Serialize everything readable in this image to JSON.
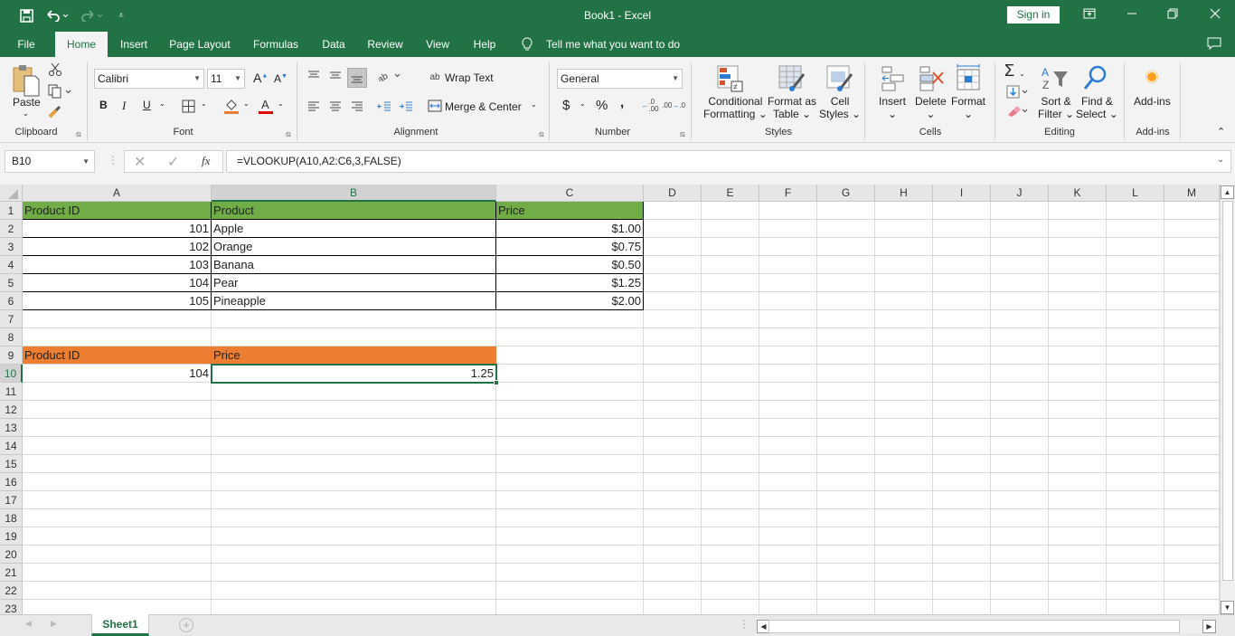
{
  "window": {
    "title": "Book1  -  Excel",
    "sign_in": "Sign in",
    "icons": {
      "save": "save-icon",
      "undo": "undo-icon",
      "redo": "redo-icon",
      "customize": "customize-qat-icon",
      "ribbon_display": "ribbon-display-options-icon",
      "minimize": "minimize-icon",
      "restore": "restore-icon",
      "close": "close-icon",
      "comments": "comments-icon"
    }
  },
  "tabs": [
    {
      "label": "File",
      "active": false
    },
    {
      "label": "Home",
      "active": true
    },
    {
      "label": "Insert",
      "active": false
    },
    {
      "label": "Page Layout",
      "active": false
    },
    {
      "label": "Formulas",
      "active": false
    },
    {
      "label": "Data",
      "active": false
    },
    {
      "label": "Review",
      "active": false
    },
    {
      "label": "View",
      "active": false
    },
    {
      "label": "Help",
      "active": false
    }
  ],
  "tell_me": "Tell me what you want to do",
  "ribbon": {
    "clipboard": {
      "label": "Clipboard",
      "paste": "Paste"
    },
    "font": {
      "label": "Font",
      "name": "Calibri",
      "size": "11",
      "bold": "B",
      "italic": "I",
      "underline": "U",
      "fill_color": "#ed7d31",
      "font_color": "#e00000"
    },
    "alignment": {
      "label": "Alignment",
      "wrap_text": "Wrap Text",
      "merge_center": "Merge & Center"
    },
    "number": {
      "label": "Number",
      "format": "General",
      "currency": "$",
      "percent": "%",
      "comma": ","
    },
    "styles": {
      "label": "Styles",
      "conditional_1": "Conditional",
      "conditional_2": "Formatting",
      "format_table_1": "Format as",
      "format_table_2": "Table",
      "cell_styles_1": "Cell",
      "cell_styles_2": "Styles"
    },
    "cells": {
      "label": "Cells",
      "insert": "Insert",
      "delete": "Delete",
      "format": "Format"
    },
    "editing": {
      "label": "Editing",
      "sort_1": "Sort &",
      "sort_2": "Filter",
      "find_1": "Find &",
      "find_2": "Select"
    },
    "addins": {
      "label": "Add-ins",
      "button": "Add-ins"
    }
  },
  "formula_bar": {
    "name_box": "B10",
    "fx": "fx",
    "formula": "=VLOOKUP(A10,A2:C6,3,FALSE)"
  },
  "sheet": {
    "columns": [
      "A",
      "B",
      "C",
      "D",
      "E",
      "F",
      "G",
      "H",
      "I",
      "J",
      "K",
      "L",
      "M"
    ],
    "selected_column": "B",
    "selected_row": 10,
    "rows": [
      1,
      2,
      3,
      4,
      5,
      6,
      7,
      8,
      9,
      10,
      11,
      12,
      13,
      14,
      15,
      16,
      17,
      18,
      19,
      20,
      21,
      22,
      23
    ],
    "table1": {
      "headers": [
        "Product ID",
        "Product",
        "Price"
      ],
      "header_color": "#70ad47",
      "data": [
        [
          "101",
          "Apple",
          "$1.00"
        ],
        [
          "102",
          "Orange",
          "$0.75"
        ],
        [
          "103",
          "Banana",
          "$0.50"
        ],
        [
          "104",
          "Pear",
          "$1.25"
        ],
        [
          "105",
          "Pineapple",
          "$2.00"
        ]
      ]
    },
    "table2": {
      "headers": [
        "Product ID",
        "Price"
      ],
      "header_color": "#ed7d31",
      "data": [
        [
          "104",
          "1.25"
        ]
      ]
    }
  },
  "status": {
    "sheet_tab": "Sheet1",
    "add_sheet": "+"
  }
}
